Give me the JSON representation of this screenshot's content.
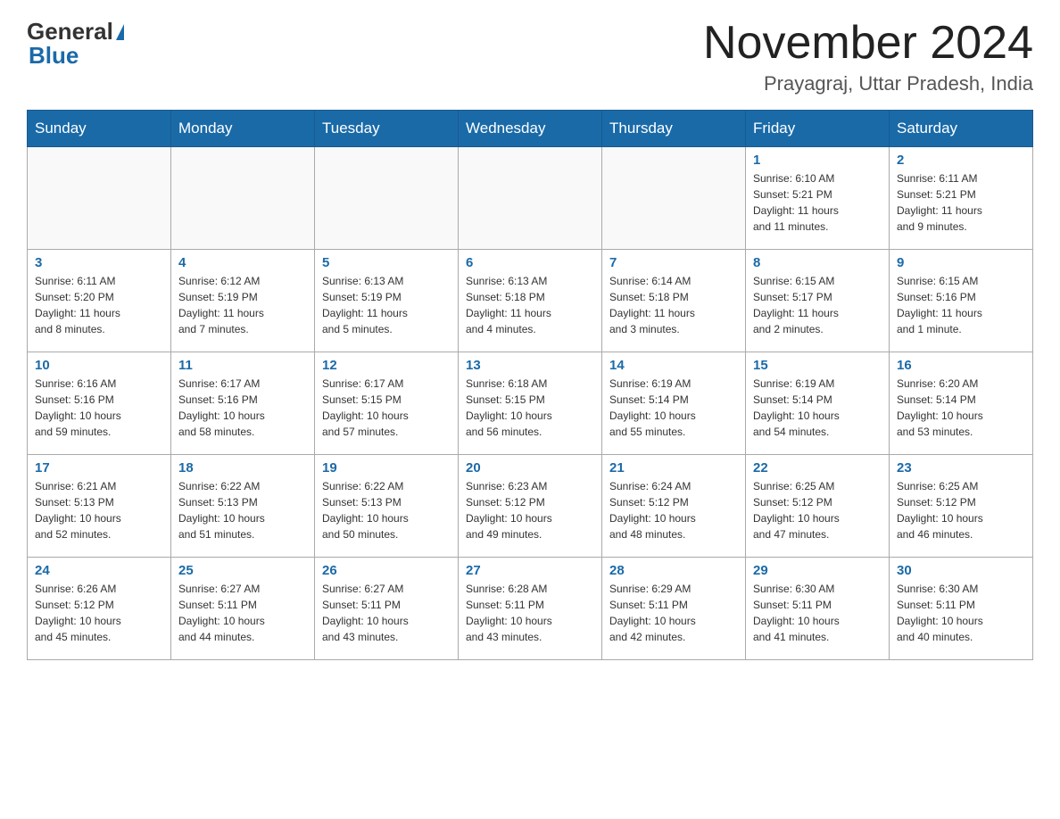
{
  "header": {
    "title": "November 2024",
    "subtitle": "Prayagraj, Uttar Pradesh, India",
    "logo_general": "General",
    "logo_blue": "Blue"
  },
  "days_of_week": [
    "Sunday",
    "Monday",
    "Tuesday",
    "Wednesday",
    "Thursday",
    "Friday",
    "Saturday"
  ],
  "weeks": [
    {
      "days": [
        {
          "num": "",
          "info": ""
        },
        {
          "num": "",
          "info": ""
        },
        {
          "num": "",
          "info": ""
        },
        {
          "num": "",
          "info": ""
        },
        {
          "num": "",
          "info": ""
        },
        {
          "num": "1",
          "info": "Sunrise: 6:10 AM\nSunset: 5:21 PM\nDaylight: 11 hours\nand 11 minutes."
        },
        {
          "num": "2",
          "info": "Sunrise: 6:11 AM\nSunset: 5:21 PM\nDaylight: 11 hours\nand 9 minutes."
        }
      ]
    },
    {
      "days": [
        {
          "num": "3",
          "info": "Sunrise: 6:11 AM\nSunset: 5:20 PM\nDaylight: 11 hours\nand 8 minutes."
        },
        {
          "num": "4",
          "info": "Sunrise: 6:12 AM\nSunset: 5:19 PM\nDaylight: 11 hours\nand 7 minutes."
        },
        {
          "num": "5",
          "info": "Sunrise: 6:13 AM\nSunset: 5:19 PM\nDaylight: 11 hours\nand 5 minutes."
        },
        {
          "num": "6",
          "info": "Sunrise: 6:13 AM\nSunset: 5:18 PM\nDaylight: 11 hours\nand 4 minutes."
        },
        {
          "num": "7",
          "info": "Sunrise: 6:14 AM\nSunset: 5:18 PM\nDaylight: 11 hours\nand 3 minutes."
        },
        {
          "num": "8",
          "info": "Sunrise: 6:15 AM\nSunset: 5:17 PM\nDaylight: 11 hours\nand 2 minutes."
        },
        {
          "num": "9",
          "info": "Sunrise: 6:15 AM\nSunset: 5:16 PM\nDaylight: 11 hours\nand 1 minute."
        }
      ]
    },
    {
      "days": [
        {
          "num": "10",
          "info": "Sunrise: 6:16 AM\nSunset: 5:16 PM\nDaylight: 10 hours\nand 59 minutes."
        },
        {
          "num": "11",
          "info": "Sunrise: 6:17 AM\nSunset: 5:16 PM\nDaylight: 10 hours\nand 58 minutes."
        },
        {
          "num": "12",
          "info": "Sunrise: 6:17 AM\nSunset: 5:15 PM\nDaylight: 10 hours\nand 57 minutes."
        },
        {
          "num": "13",
          "info": "Sunrise: 6:18 AM\nSunset: 5:15 PM\nDaylight: 10 hours\nand 56 minutes."
        },
        {
          "num": "14",
          "info": "Sunrise: 6:19 AM\nSunset: 5:14 PM\nDaylight: 10 hours\nand 55 minutes."
        },
        {
          "num": "15",
          "info": "Sunrise: 6:19 AM\nSunset: 5:14 PM\nDaylight: 10 hours\nand 54 minutes."
        },
        {
          "num": "16",
          "info": "Sunrise: 6:20 AM\nSunset: 5:14 PM\nDaylight: 10 hours\nand 53 minutes."
        }
      ]
    },
    {
      "days": [
        {
          "num": "17",
          "info": "Sunrise: 6:21 AM\nSunset: 5:13 PM\nDaylight: 10 hours\nand 52 minutes."
        },
        {
          "num": "18",
          "info": "Sunrise: 6:22 AM\nSunset: 5:13 PM\nDaylight: 10 hours\nand 51 minutes."
        },
        {
          "num": "19",
          "info": "Sunrise: 6:22 AM\nSunset: 5:13 PM\nDaylight: 10 hours\nand 50 minutes."
        },
        {
          "num": "20",
          "info": "Sunrise: 6:23 AM\nSunset: 5:12 PM\nDaylight: 10 hours\nand 49 minutes."
        },
        {
          "num": "21",
          "info": "Sunrise: 6:24 AM\nSunset: 5:12 PM\nDaylight: 10 hours\nand 48 minutes."
        },
        {
          "num": "22",
          "info": "Sunrise: 6:25 AM\nSunset: 5:12 PM\nDaylight: 10 hours\nand 47 minutes."
        },
        {
          "num": "23",
          "info": "Sunrise: 6:25 AM\nSunset: 5:12 PM\nDaylight: 10 hours\nand 46 minutes."
        }
      ]
    },
    {
      "days": [
        {
          "num": "24",
          "info": "Sunrise: 6:26 AM\nSunset: 5:12 PM\nDaylight: 10 hours\nand 45 minutes."
        },
        {
          "num": "25",
          "info": "Sunrise: 6:27 AM\nSunset: 5:11 PM\nDaylight: 10 hours\nand 44 minutes."
        },
        {
          "num": "26",
          "info": "Sunrise: 6:27 AM\nSunset: 5:11 PM\nDaylight: 10 hours\nand 43 minutes."
        },
        {
          "num": "27",
          "info": "Sunrise: 6:28 AM\nSunset: 5:11 PM\nDaylight: 10 hours\nand 43 minutes."
        },
        {
          "num": "28",
          "info": "Sunrise: 6:29 AM\nSunset: 5:11 PM\nDaylight: 10 hours\nand 42 minutes."
        },
        {
          "num": "29",
          "info": "Sunrise: 6:30 AM\nSunset: 5:11 PM\nDaylight: 10 hours\nand 41 minutes."
        },
        {
          "num": "30",
          "info": "Sunrise: 6:30 AM\nSunset: 5:11 PM\nDaylight: 10 hours\nand 40 minutes."
        }
      ]
    }
  ]
}
